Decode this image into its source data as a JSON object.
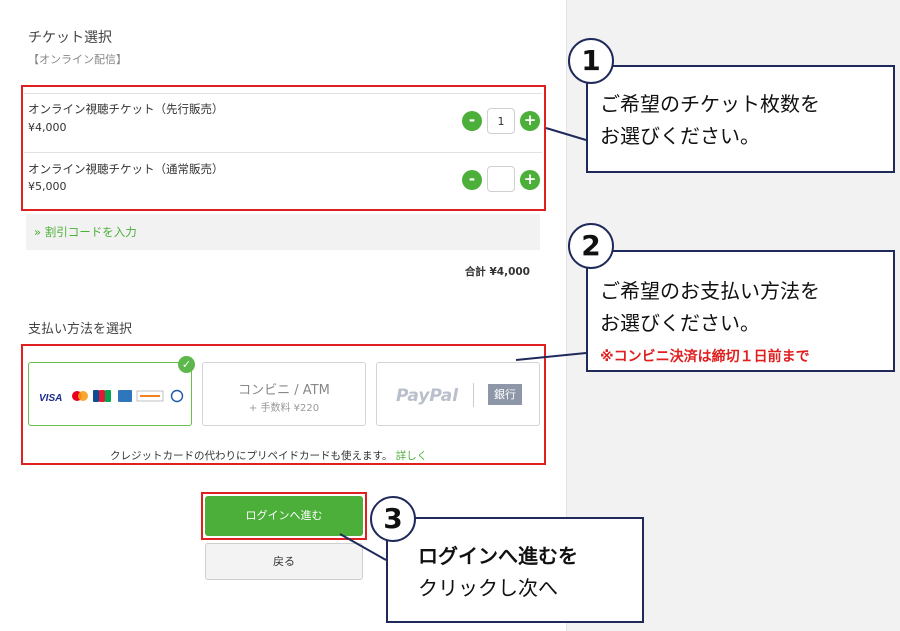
{
  "tickets": {
    "title": "チケット選択",
    "subtitle": "【オンライン配信】",
    "items": [
      {
        "name": "オンライン視聴チケット（先行販売）",
        "price": "¥4,000",
        "quantity": "1"
      },
      {
        "name": "オンライン視聴チケット（通常販売）",
        "price": "¥5,000",
        "quantity": ""
      }
    ],
    "minus": "-",
    "plus": "+"
  },
  "discount": {
    "label": "» 割引コードを入力"
  },
  "total": {
    "label": "合計 ¥4,000"
  },
  "payment": {
    "title": "支払い方法を選択",
    "card_logos": [
      "VISA",
      "Mastercard",
      "JCB",
      "AMEX",
      "DISCOVER",
      "Diners Club"
    ],
    "visa_text": "VISA",
    "convenience": {
      "title": "コンビニ / ATM",
      "fee": "+ 手数料 ¥220"
    },
    "paypal": {
      "label": "PayPal",
      "bank": "銀行"
    },
    "note": "クレジットカードの代わりにプリペイドカードも使えます。",
    "note_link": "詳しく"
  },
  "buttons": {
    "login": "ログインへ進む",
    "back": "戻る"
  },
  "callouts": [
    {
      "number": "1",
      "lines": [
        "ご希望のチケット枚数を",
        "お選びください。"
      ]
    },
    {
      "number": "2",
      "lines": [
        "ご希望のお支払い方法を",
        "お選びください。"
      ],
      "note": "※コンビニ決済は締切１日前まで"
    },
    {
      "number": "3",
      "lines": [
        "ログインへ進むを",
        "クリックし次へ"
      ]
    }
  ],
  "colors": {
    "accent": "#4caf3a",
    "highlight": "#e02020",
    "callout_border": "#1f2a5b"
  },
  "icons": {
    "check": "check-icon"
  }
}
